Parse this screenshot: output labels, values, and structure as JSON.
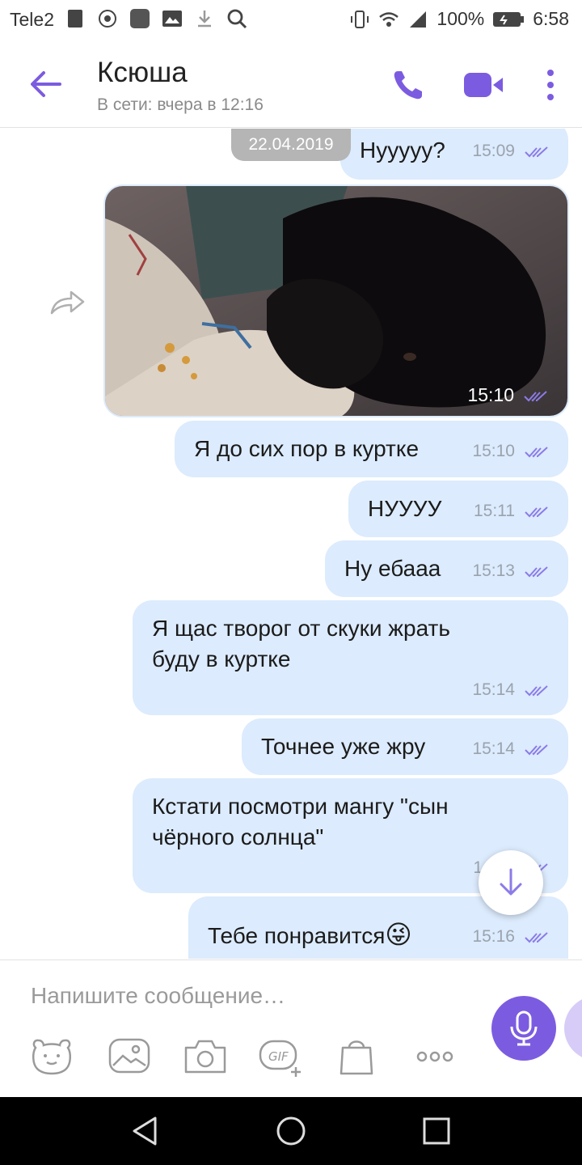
{
  "status_bar": {
    "carrier": "Tele2",
    "battery": "100%",
    "time": "6:58"
  },
  "header": {
    "contact_name": "Ксюша",
    "status": "В сети: вчера в 12:16"
  },
  "date_chip": "22.04.2019",
  "messages": [
    {
      "text": "Нууууу?",
      "time": "15:09"
    },
    {
      "type": "photo",
      "time": "15:10"
    },
    {
      "text": "Я до сих пор в куртке",
      "time": "15:10"
    },
    {
      "text": "НУУУУ",
      "time": "15:11"
    },
    {
      "text": "Ну ебааа",
      "time": "15:13"
    },
    {
      "text_line1": "Я щас творог от скуки жрать",
      "text_line2": "буду в куртке",
      "time": "15:14"
    },
    {
      "text": "Точнее уже жру",
      "time": "15:14"
    },
    {
      "text_line1": "Кстати посмотри мангу \"сын",
      "text_line2": "чёрного солнца\"",
      "time": "1"
    },
    {
      "text": "Тебе понравится",
      "emoji": "😜",
      "time": "15:16"
    }
  ],
  "composer": {
    "placeholder": "Напишите сообщение…"
  },
  "colors": {
    "accent": "#7b5ce0",
    "bubble": "#dcebfd",
    "tick": "#8b7be8"
  }
}
